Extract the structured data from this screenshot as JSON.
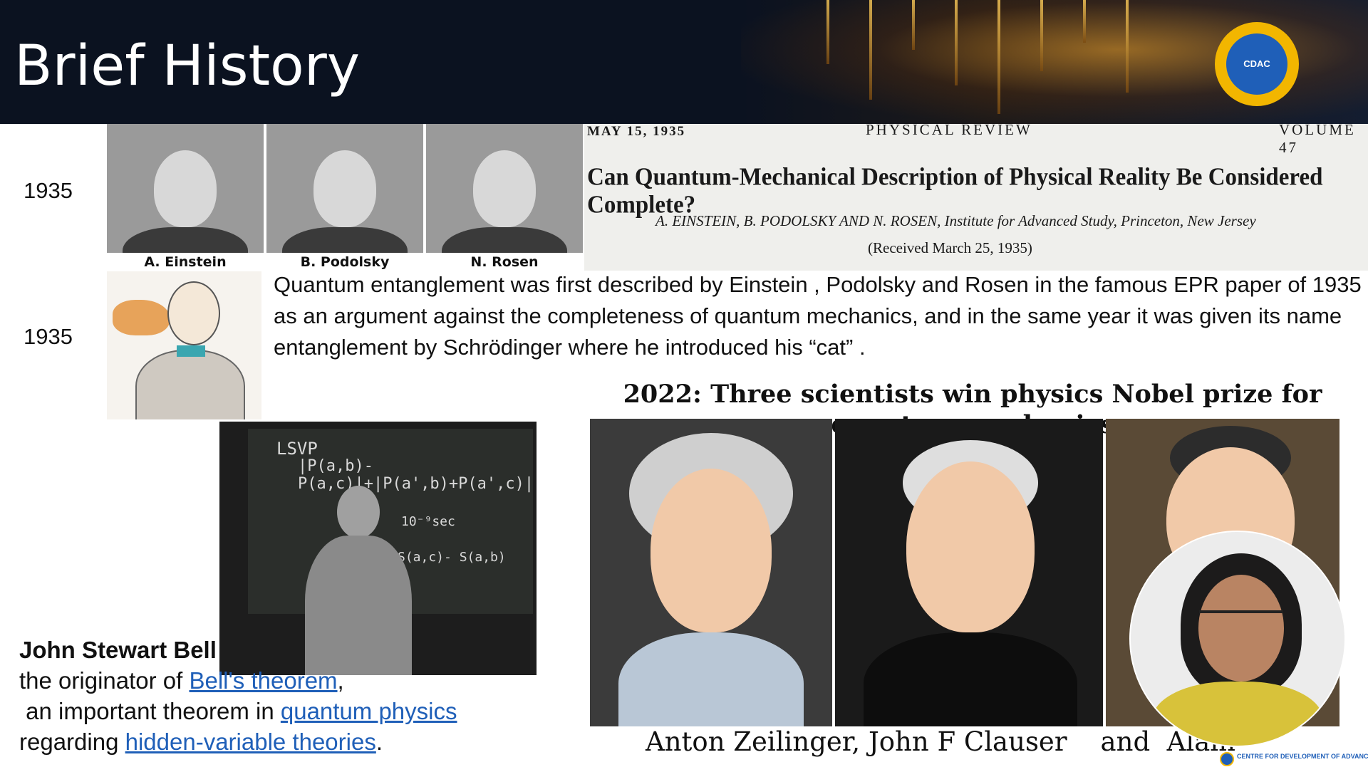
{
  "slide": {
    "title": "Brief History",
    "logo_text": "CDAC"
  },
  "timeline": [
    {
      "year": "1935"
    },
    {
      "year": "1935"
    }
  ],
  "epr_photos": [
    {
      "caption": "A. Einstein"
    },
    {
      "caption": "B. Podolsky"
    },
    {
      "caption": "N. Rosen"
    }
  ],
  "paper": {
    "date": "MAY 15, 1935",
    "journal": "PHYSICAL REVIEW",
    "volume": "VOLUME 47",
    "title": "Can Quantum-Mechanical Description of Physical Reality Be Considered Complete?",
    "authors": "A. EINSTEIN, B. PODOLSKY AND N. ROSEN, Institute for Advanced Study, Princeton, New Jersey",
    "received": "(Received March 25, 1935)"
  },
  "entanglement_text": "Quantum entanglement was first described by Einstein , Podolsky and Rosen in the famous EPR paper of 1935 as an argument against the completeness of quantum mechanics, and  in the same year it was given its name entanglement by Schrödinger where he introduced his “cat” .",
  "nobel": {
    "title": "2022: Three scientists win physics Nobel prize for quantum mechanics",
    "names": "Anton Zeilinger, John F Clauser    and  Alain"
  },
  "bell": {
    "name": "John Stewart Bell",
    "line1_prefix": "the originator of ",
    "line1_link": "Bell's theorem",
    "line1_suffix": ",",
    "line2_prefix": " an important theorem in ",
    "line2_link": "quantum physics",
    "line3_prefix": "regarding ",
    "line3_link": "hidden-variable theories",
    "line3_suffix": ".",
    "chalk_1": "LSVP",
    "chalk_2": "|P(a,b)-P(a,c)|+|P(a',b)+P(a',c)|",
    "chalk_3": "10⁻⁹sec",
    "chalk_4": "S(a,c)- S(a,b)"
  },
  "footer": {
    "logo_text": "CENTRE FOR DEVELOPMENT OF ADVANCED COMPUTING"
  },
  "colors": {
    "header_bg": "#0b1220",
    "link": "#1f5fb8",
    "logo_gold": "#f2b600"
  }
}
